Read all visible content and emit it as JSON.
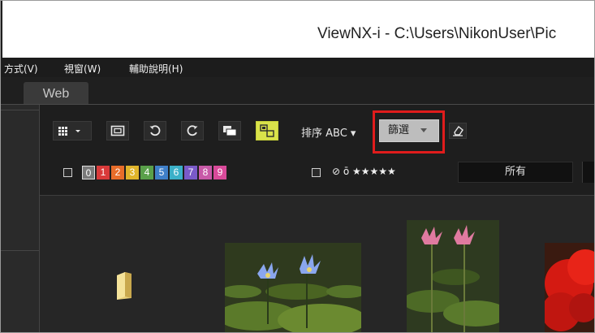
{
  "window": {
    "title": "ViewNX-i - C:\\Users\\NikonUser\\Pic"
  },
  "menubar": {
    "items": [
      "方式(V)",
      "視窗(W)",
      "輔助說明(H)"
    ]
  },
  "tabs": {
    "web_label": "Web"
  },
  "toolbar": {
    "sort_label": "排序 ABC ▾",
    "filter_label": "篩選",
    "highlight_color": "#e01c1c"
  },
  "filter_bar": {
    "labels": [
      "0",
      "1",
      "2",
      "3",
      "4",
      "5",
      "6",
      "7",
      "8",
      "9"
    ],
    "label_colors": [
      "#7a7a7a",
      "#d93a3a",
      "#e86d2a",
      "#e0b42b",
      "#5aa04a",
      "#3f7fc8",
      "#3bb0c8",
      "#7a5ac8",
      "#c85aa8",
      "#d94a9a"
    ],
    "rating_text": "⊘ ō ★★★★★",
    "all_value": "所有"
  },
  "content": {
    "items": [
      {
        "kind": "folder",
        "icon": "folder-icon"
      },
      {
        "kind": "photo",
        "subject": "blue water lilies"
      },
      {
        "kind": "photo",
        "subject": "pink lotus"
      },
      {
        "kind": "photo",
        "subject": "red flower"
      }
    ]
  }
}
